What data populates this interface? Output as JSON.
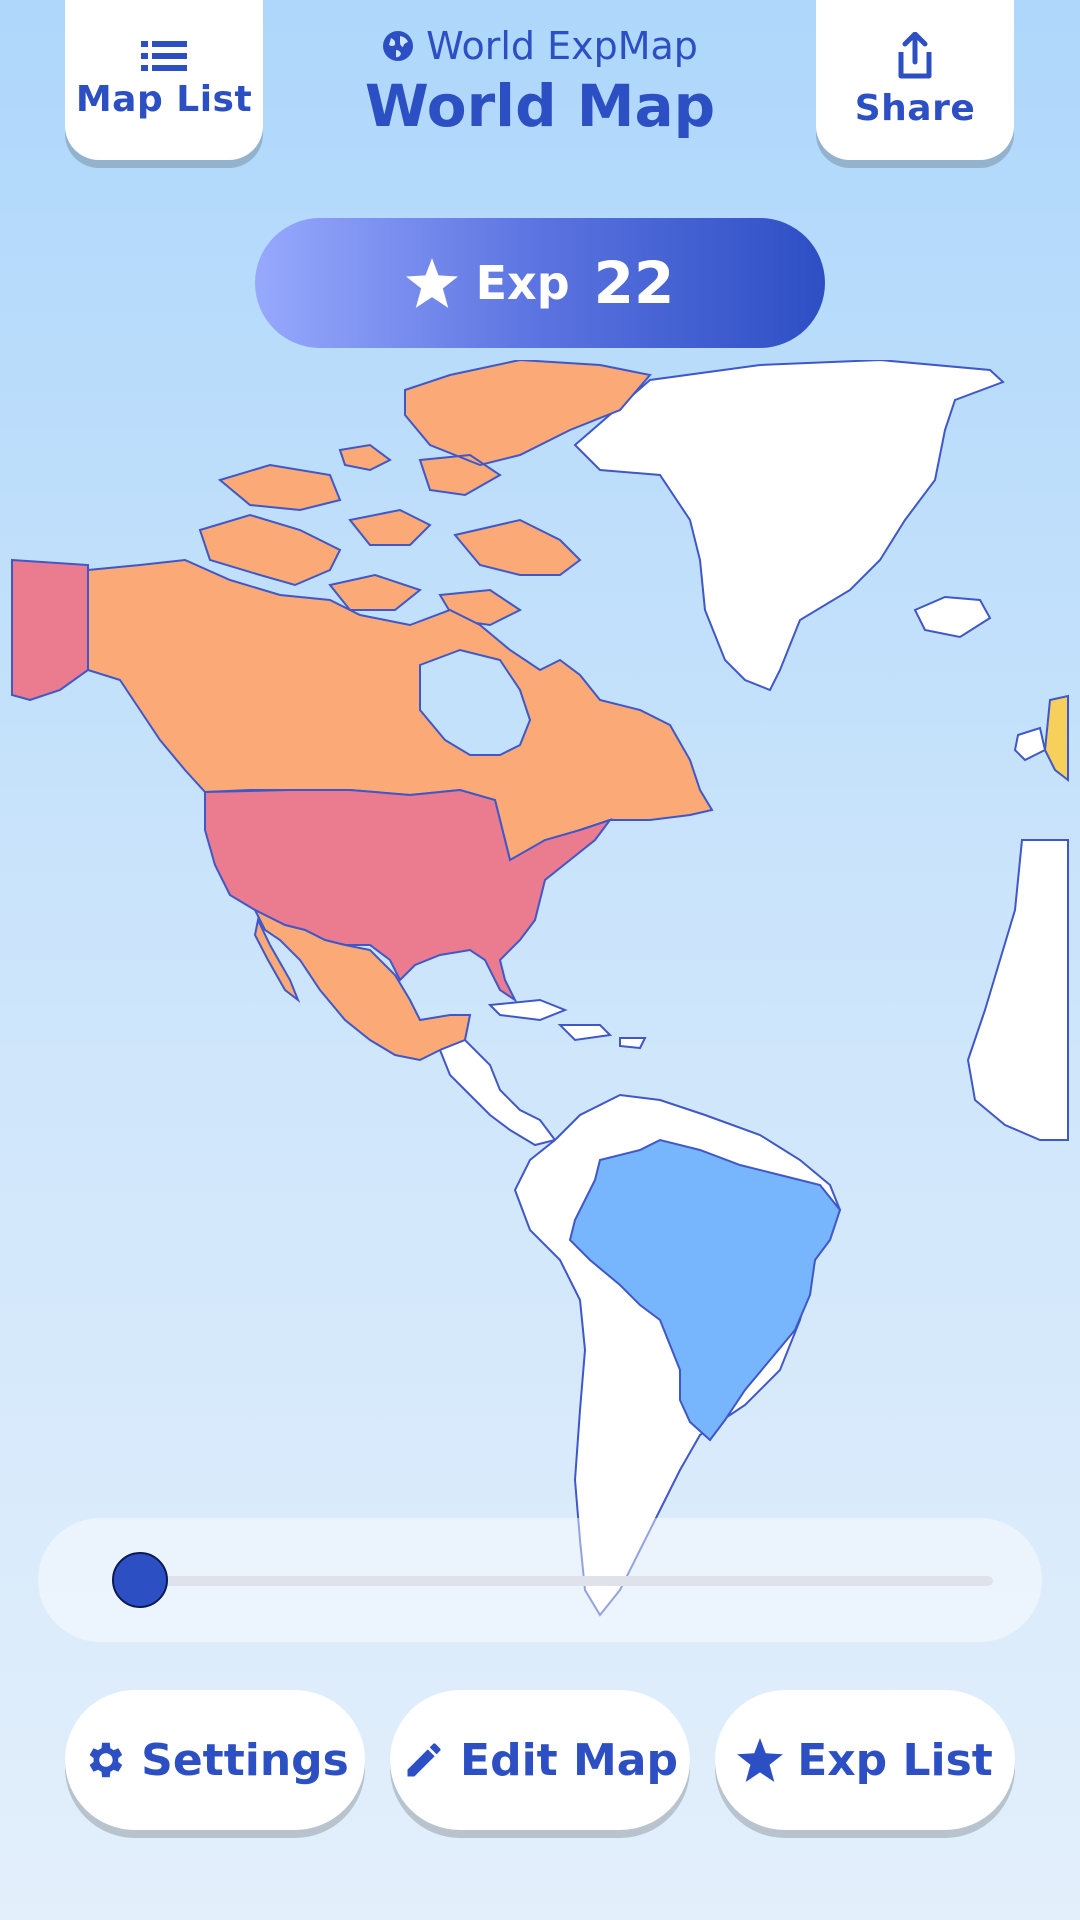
{
  "header": {
    "app_name": "World ExpMap",
    "title": "World Map"
  },
  "toolbar": {
    "map_list_label": "Map List",
    "share_label": "Share"
  },
  "exp": {
    "label": "Exp",
    "value": "22"
  },
  "map": {
    "level_colors": {
      "level_high": "#eb7c8f",
      "level_mid": "#fbaa77",
      "level_low": "#77b5fd",
      "level_min": "#f7cf5b",
      "unvisited": "#ffffff",
      "border": "#3f57c9"
    }
  },
  "slider": {
    "value_fraction": 0.0
  },
  "bottom_bar": {
    "settings_label": "Settings",
    "edit_map_label": "Edit Map",
    "exp_list_label": "Exp List"
  },
  "colors": {
    "accent": "#2d4fc4",
    "pill_start": "#97a9fd",
    "pill_end": "#2d4fc4"
  }
}
